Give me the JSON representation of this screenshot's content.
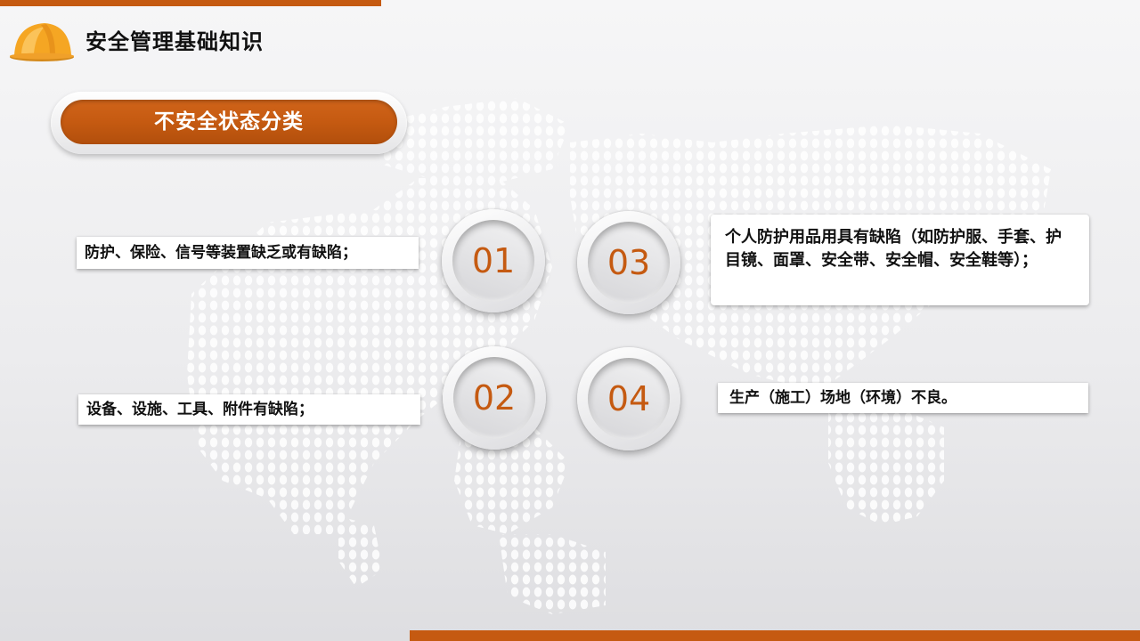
{
  "header": {
    "title": "安全管理基础知识"
  },
  "section": {
    "title": "不安全状态分类"
  },
  "items": [
    {
      "number": "01",
      "text": "防护、保险、信号等装置缺乏或有缺陷；"
    },
    {
      "number": "02",
      "text": "设备、设施、工具、附件有缺陷；"
    },
    {
      "number": "03",
      "text": "个人防护用品用具有缺陷（如防护服、手套、护目镜、面罩、安全带、安全帽、安全鞋等）；"
    },
    {
      "number": "04",
      "text": "生产（施工）场地（环境）不良。"
    }
  ],
  "colors": {
    "accent": "#c55a11",
    "helmet": "#f5a623"
  }
}
